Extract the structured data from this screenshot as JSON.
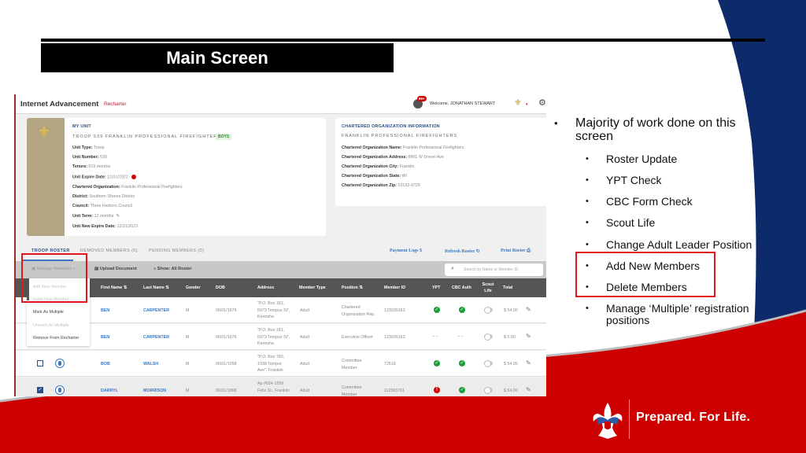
{
  "slide": {
    "title": "Main Screen",
    "tagline": "Prepared. For Life.",
    "colors": {
      "navy": "#0d2a6b",
      "red": "#cc0000",
      "highlight": "#e0181e"
    }
  },
  "app": {
    "title": "Internet Advancement",
    "subtitle": "Recharter",
    "notification_badge": "99+",
    "welcome": "Welcome, JONATHAN STEWART"
  },
  "unit": {
    "heading": "MY UNIT",
    "name": "TROOP 539 FRANKLIN PROFESSIONAL FIREFIGHTERS",
    "badge": "BOYS",
    "fields": [
      {
        "label": "Unit Type:",
        "value": "Troop"
      },
      {
        "label": "Unit Number:",
        "value": "539"
      },
      {
        "label": "Tenure:",
        "value": "619 months"
      },
      {
        "label": "Unit Expire Date:",
        "value": "12/31/2022"
      },
      {
        "label": "Chartered Organization:",
        "value": "Franklin Professional Firefighters"
      },
      {
        "label": "District:",
        "value": "Southern Shores District"
      },
      {
        "label": "Council:",
        "value": "Three Harbors Council"
      },
      {
        "label": "Unit Term:",
        "value": "12 months"
      },
      {
        "label": "Unit New Expire Date:",
        "value": "12/31/2023"
      }
    ]
  },
  "org": {
    "heading": "CHARTERED ORGANIZATION INFORMATION",
    "name": "FRANKLIN PROFESSIONAL FIREFIGHTERS",
    "fields": [
      {
        "label": "Chartered Organization Name:",
        "value": "Franklin Professional Firefighters"
      },
      {
        "label": "Chartered Organization Address:",
        "value": "8901 W Dresel Ave"
      },
      {
        "label": "Chartered Organization City:",
        "value": "Franklin"
      },
      {
        "label": "Chartered Organization State:",
        "value": "WI"
      },
      {
        "label": "Chartered Organization Zip:",
        "value": "53132-9725"
      }
    ]
  },
  "tabs": [
    "TROOP ROSTER",
    "REMOVED MEMBERS (0)",
    "PENDING MEMBERS (0)"
  ],
  "actions": {
    "payment_logs": "Payment Logs",
    "refresh_roster": "Refresh Roster",
    "print_roster": "Print Roster"
  },
  "toolbar": {
    "manage_members": "Manage Members",
    "upload_document": "Upload Document",
    "show": "Show: All Roster",
    "search_placeholder": "Search by Name or Member ID"
  },
  "menu": {
    "items": [
      {
        "label": "Add New Member",
        "enabled": false
      },
      {
        "label": "Invite New Member",
        "enabled": false
      },
      {
        "label": "Mark As Multiple",
        "enabled": true
      },
      {
        "label": "Unmark As Multiple",
        "enabled": false
      },
      {
        "label": "Remove From Recharter",
        "enabled": true
      }
    ]
  },
  "table": {
    "columns": [
      "First Name",
      "Last Name",
      "Gender",
      "DOB",
      "Address",
      "Member Type",
      "Position",
      "Member ID",
      "YPT",
      "CBC Auth",
      "Scout Life",
      "Total"
    ],
    "rows": [
      {
        "first": "BEN",
        "last": "CARPENTER",
        "gender": "M",
        "dob": "06/01/1976",
        "addr1": "\"P.O. Box 181,",
        "addr2": "5973 Tempus St\",",
        "addr3": "Kenosha",
        "type": "Adult",
        "pos1": "Chartered",
        "pos2": "Organization Rep.",
        "id": "123935163",
        "ypt": "ok",
        "cbc": "ok",
        "scout_life": false,
        "total": "$ 54.00",
        "checked": null
      },
      {
        "first": "BEN",
        "last": "CARPENTER",
        "gender": "M",
        "dob": "06/01/1976",
        "addr1": "\"P.O. Box 181,",
        "addr2": "5973 Tempus St\",",
        "addr3": "Kenosha",
        "type": "Adult",
        "pos1": "Executive Officer",
        "pos2": "",
        "id": "123935163",
        "ypt": "none",
        "cbc": "none",
        "scout_life": false,
        "total": "$ 0.00",
        "checked": null
      },
      {
        "first": "BOB",
        "last": "WALSH",
        "gender": "M",
        "dob": "06/01/1958",
        "addr1": "\"P.O. Box 782,",
        "addr2": "1038 Tempor",
        "addr3": "Ave\", Franklin",
        "type": "Adult",
        "pos1": "Committee",
        "pos2": "Member",
        "id": "72618",
        "ypt": "ok",
        "cbc": "ok",
        "scout_life": false,
        "total": "$ 54.00",
        "checked": false
      },
      {
        "first": "DARRYL",
        "last": "MORRISON",
        "gender": "M",
        "dob": "06/01/1968",
        "addr1": "Ap #654-1599",
        "addr2": "Felis St., Franklin",
        "addr3": "",
        "type": "Adult",
        "pos1": "Committee",
        "pos2": "Member",
        "id": "112565761",
        "ypt": "bad",
        "cbc": "ok",
        "scout_life": false,
        "total": "$ 54.00",
        "checked": true
      }
    ],
    "dash": "– –"
  },
  "bullets": {
    "main": "Majority of work done on this screen",
    "items": [
      "Roster Update",
      "YPT Check",
      "CBC Form Check",
      "Scout Life",
      "Change Adult Leader Position",
      "Add New Members",
      "Delete Members",
      "Manage ‘Multiple’ registration positions"
    ]
  }
}
